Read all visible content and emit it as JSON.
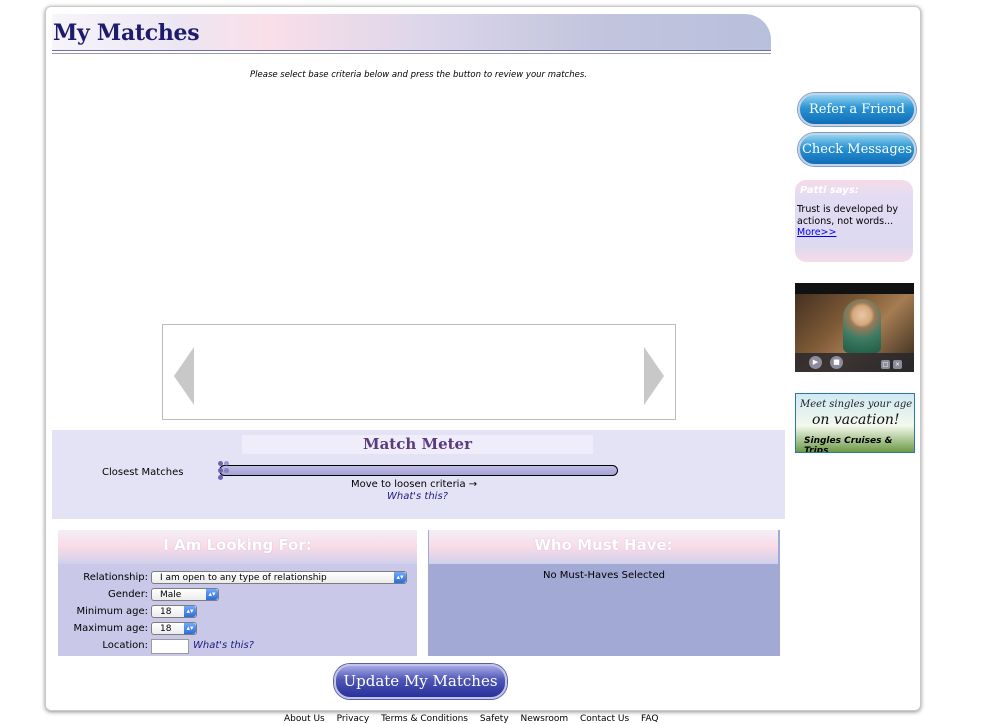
{
  "header": {
    "title": "My Matches"
  },
  "instructions": "Please select base criteria below and press the button to review your matches.",
  "match_meter": {
    "title": "Match Meter",
    "left_label": "Closest Matches",
    "hint": "Move to loosen criteria →",
    "help_link": "What's this?",
    "level": 0
  },
  "looking_for": {
    "title": "I Am Looking For:",
    "relationship_label": "Relationship:",
    "relationship_value": "I am open to any type of relationship",
    "gender_label": "Gender:",
    "gender_value": "Male",
    "min_age_label": "Minimum age:",
    "min_age_value": "18",
    "max_age_label": "Maximum age:",
    "max_age_value": "18",
    "location_label": "Location:",
    "location_value": "",
    "help_link": "What's this?"
  },
  "must_have": {
    "title": "Who Must Have:",
    "empty_text": "No Must-Haves Selected"
  },
  "update_button": "Update My Matches",
  "sidebar": {
    "refer_button": "Refer a Friend",
    "messages_button": "Check Messages",
    "tip_title": "Patti says:",
    "tip_text": "Trust is developed by actions, not words...",
    "tip_link": "More>>",
    "ad_line1": "Meet singles your age",
    "ad_line2": "on vacation!",
    "ad_line3": "Singles Cruises & Trips"
  },
  "footer": {
    "links": [
      "About Us",
      "Privacy",
      "Terms & Conditions",
      "Safety",
      "Newsroom",
      "Contact Us",
      "FAQ"
    ]
  },
  "colors": {
    "title_text": "#1d1b6e",
    "meter_bg": "#e4e3f5",
    "must_have_bg": "#a2a9d4",
    "looking_for_bg": "#c9c8e8",
    "link_blue": "#0000ee"
  }
}
